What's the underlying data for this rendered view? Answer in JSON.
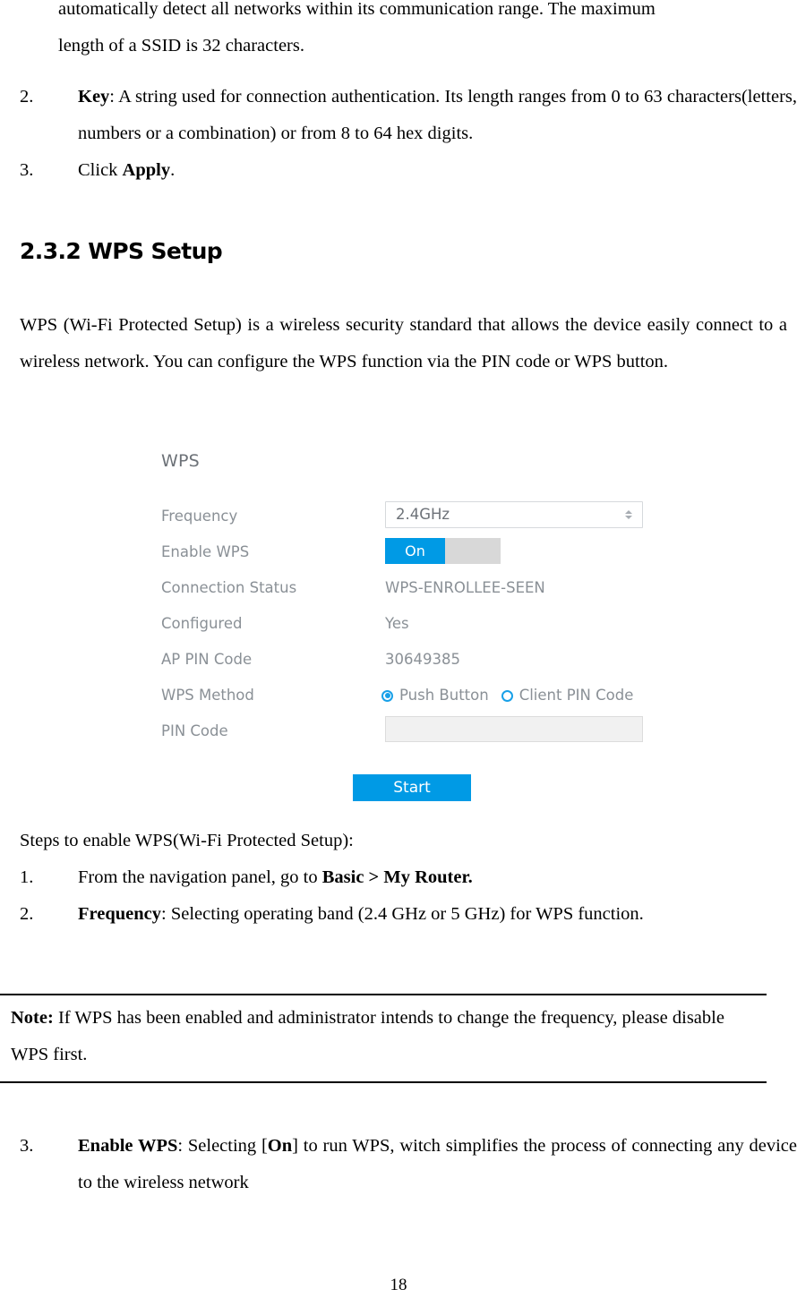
{
  "page": {
    "number": "18"
  },
  "body": {
    "continued_paragraph_line1": "automatically detect all networks within its communication range. The maximum",
    "continued_paragraph_line2": "length of a SSID is 32 characters.",
    "item2": {
      "number": "2.",
      "term": "Key",
      "text_a": ": A string used for connection authentication. Its length ranges from 0 to 63 characters(letters, numbers or a combination) or from 8 to 64 hex digits."
    },
    "item3": {
      "number": "3.",
      "text_a": "Click ",
      "term": "Apply",
      "text_b": "."
    }
  },
  "heading": {
    "text": "2.3.2 WPS Setup"
  },
  "intro_paragraph": "WPS (Wi-Fi Protected Setup) is a wireless security standard that allows the device easily connect to a wireless network. You can configure the WPS function via the PIN code or WPS button.",
  "wps_panel": {
    "title": "WPS",
    "accent_color": "#009ae5",
    "label_color": "#8a9096",
    "rows": [
      {
        "label": "Frequency",
        "control": "select",
        "value": "2.4GHz"
      },
      {
        "label": "Enable WPS",
        "control": "toggle",
        "value": "On"
      },
      {
        "label": "Connection Status",
        "control": "text",
        "value": "WPS-ENROLLEE-SEEN"
      },
      {
        "label": "Configured",
        "control": "text",
        "value": "Yes"
      },
      {
        "label": "AP PIN Code",
        "control": "text",
        "value": "30649385"
      },
      {
        "label": "WPS Method",
        "control": "radios",
        "value": "Push Button"
      },
      {
        "label": "PIN Code",
        "control": "input",
        "value": ""
      }
    ],
    "radio_options": [
      {
        "label": "Push Button",
        "selected": true
      },
      {
        "label": "Client PIN Code",
        "selected": false
      }
    ],
    "start_button": "Start"
  },
  "steps": {
    "intro": "Steps to enable WPS(Wi-Fi Protected Setup):",
    "item1": {
      "number": "1.",
      "text_a": "From the navigation panel, go to ",
      "term": "Basic > My Router."
    },
    "item2": {
      "number": "2.",
      "term": "Frequency",
      "text_a": ": Selecting operating band (2.4 GHz or 5 GHz) for WPS function."
    },
    "item3": {
      "number": "3.",
      "term": "Enable WPS",
      "text_a": ": Selecting [",
      "term2": "On",
      "text_b": "] to run WPS, witch simplifies the process of connecting any device to the wireless network"
    }
  },
  "note": {
    "label": "Note:",
    "text": " If WPS has been enabled and administrator intends to change the frequency, please disable WPS first."
  }
}
